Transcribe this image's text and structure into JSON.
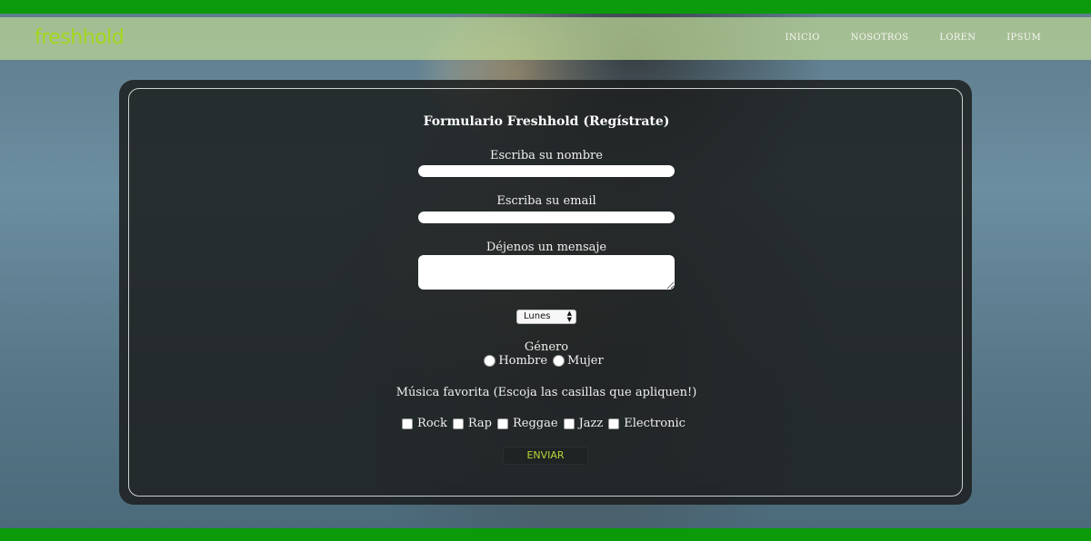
{
  "brand": {
    "logo_text": "freshhold",
    "logo_color": "#a6d61c",
    "accent_green": "#0a9a0a"
  },
  "nav": {
    "items": [
      "INICIO",
      "NOSOTROS",
      "LOREN",
      "IPSUM"
    ]
  },
  "form": {
    "title": "Formulario Freshhold (Regístrate)",
    "name_label": "Escriba su nombre",
    "name_value": "",
    "email_label": "Escriba su email",
    "email_value": "",
    "message_label": "Déjenos un mensaje",
    "message_value": "",
    "day_select_value": "Lunes",
    "gender_label": "Género",
    "gender_options": [
      "Hombre",
      "Mujer"
    ],
    "music_label": "Música favorita (Escoja las casillas que apliquen!)",
    "music_options": [
      "Rock",
      "Rap",
      "Reggae",
      "Jazz",
      "Electronic"
    ],
    "submit_label": "ENVIAR"
  }
}
